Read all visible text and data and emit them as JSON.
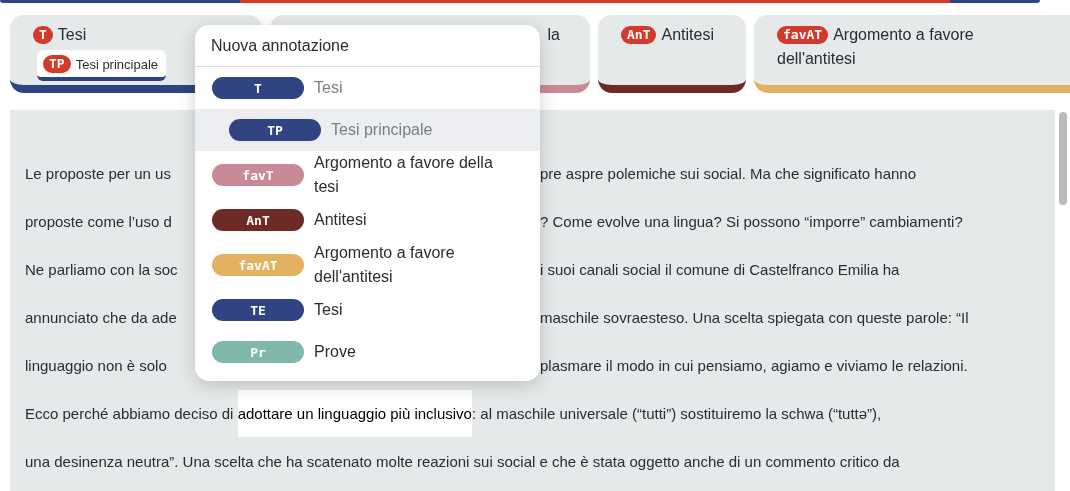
{
  "annotation_tabs": [
    {
      "badge": "T",
      "label": "Tesi",
      "color": "#2e4480",
      "children": [
        {
          "badge": "TP",
          "label": "Tesi principale",
          "color": "#2e4480"
        }
      ]
    },
    {
      "label": "la",
      "color": "#c98a98"
    },
    {
      "badge": "AnT",
      "label": "Antitesi",
      "color": "#6e2a26"
    },
    {
      "badge": "favAT",
      "label": "Argomento a favore dell'antitesi",
      "color": "#e2b162"
    }
  ],
  "text_lines": [
    {
      "kind": "split",
      "left": "Le proposte per un us",
      "right": "pre aspre polemiche sui social. Ma che significato hanno"
    },
    {
      "kind": "split",
      "left": "proposte come l’uso d",
      "right": "? Come evolve una lingua? Si possono “imporre” cambiamenti?"
    },
    {
      "kind": "split",
      "left": "Ne parliamo con la soc",
      "right": "i suoi canali social il comune di Castelfranco Emilia ha"
    },
    {
      "kind": "split",
      "left": "annunciato che da ade",
      "right": "maschile sovraesteso. Una scelta spiegata con queste parole: “Il"
    },
    {
      "kind": "split",
      "left": "linguaggio non è solo",
      "right": "plasmare il modo in cui pensiamo, agiamo e viviamo le relazioni."
    },
    {
      "kind": "selection",
      "before": "Ecco perché abbiamo deciso di ",
      "selected_text": "adottare un linguaggio più inclusivo",
      "after": ": al maschile universale (“tutti”) sostituiremo la schwa (“tuttə”),"
    },
    {
      "kind": "full",
      "text": "una desinenza neutra”. Una scelta che ha scatenato molte reazioni sui social e che è stata oggetto anche di un commento critico da"
    }
  ],
  "annotation_menu": {
    "title": "Nuova annotazione",
    "items": [
      {
        "badge": "T",
        "label": "Tesi",
        "color": "#2f4481",
        "disabled": true,
        "highlighted": false,
        "children": [
          {
            "badge": "TP",
            "label": "Tesi principale",
            "color": "#2f4481",
            "disabled": true,
            "highlighted": true
          }
        ]
      },
      {
        "badge": "favT",
        "label": "Argomento a favore della tesi",
        "color": "#c98a98",
        "disabled": false,
        "highlighted": false
      },
      {
        "badge": "AnT",
        "label": "Antitesi",
        "color": "#6e2a26",
        "disabled": false,
        "highlighted": false
      },
      {
        "badge": "favAT",
        "label": "Argomento a favore dell'antitesi",
        "color": "#e2b162",
        "disabled": false,
        "highlighted": false
      },
      {
        "badge": "TE",
        "label": "Tesi",
        "color": "#2f4481",
        "disabled": false,
        "highlighted": false
      },
      {
        "badge": "Pr",
        "label": "Prove",
        "color": "#7fb8aa",
        "disabled": false,
        "highlighted": false
      }
    ]
  }
}
